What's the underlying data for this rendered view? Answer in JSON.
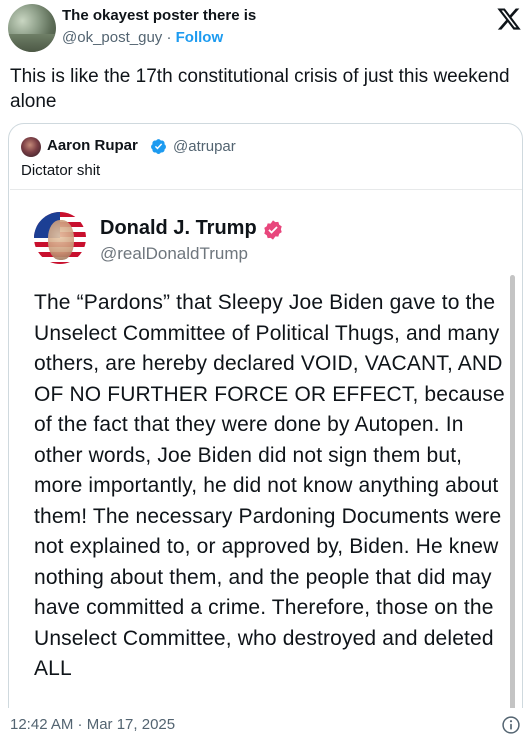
{
  "post": {
    "author_name": "The okayest poster there is",
    "author_handle": "@ok_post_guy",
    "separator": " · ",
    "follow_label": "Follow",
    "text": "This is like the 17th constitutional crisis of just this weekend alone"
  },
  "quote": {
    "author_name": "Aaron Rupar",
    "author_handle": "@atrupar",
    "text": "Dictator shit",
    "embedded": {
      "author_name": "Donald J. Trump",
      "author_handle": "@realDonaldTrump",
      "text": "The “Pardons” that Sleepy Joe Biden gave to the Unselect Committee of Political Thugs, and many others, are hereby declared VOID, VACANT, AND OF NO FURTHER FORCE OR EFFECT, because of the fact that they were done by Autopen. In other words, Joe Biden did not sign them but, more importantly, he did not know anything about them! The necessary Pardoning Documents were not explained to, or approved by, Biden. He knew nothing about them, and the people that did may have committed a crime. Therefore, those on the Unselect Committee, who destroyed and deleted ALL"
    }
  },
  "footer": {
    "timestamp": "12:42 AM · Mar 17, 2025"
  },
  "colors": {
    "verified_blue": "#1d9bf0",
    "truth_badge": "#e8467c",
    "follow": "#1d9bf0"
  },
  "icons": {
    "platform_logo": "x-logo-icon",
    "verified": "verified-badge-icon",
    "truth_verified": "truth-verified-badge-icon",
    "info": "info-icon"
  }
}
